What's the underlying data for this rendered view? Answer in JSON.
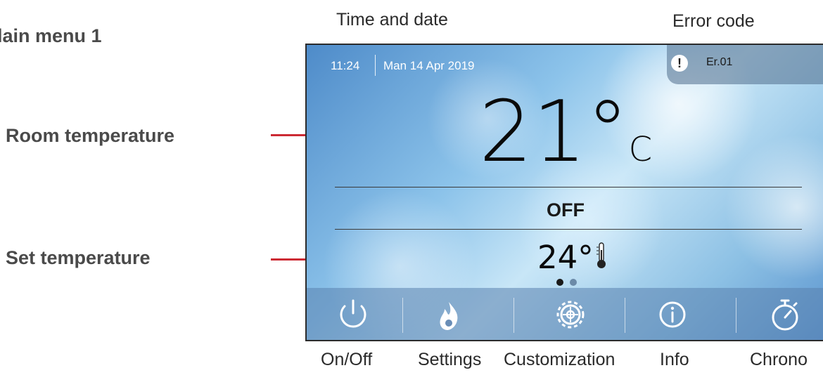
{
  "annotations": {
    "main_menu": "lain menu 1",
    "time_and_date": "Time and date",
    "error_code": "Error code",
    "room_temperature": "Room temperature",
    "set_temperature": "Set temperature"
  },
  "screen": {
    "time": "11:24",
    "date": "Man 14 Apr 2019",
    "error_code": "Er.01",
    "room_temperature": "21",
    "room_unit": "C",
    "state": "OFF",
    "set_temperature": "24",
    "page_dots": {
      "total": 2,
      "active": 0
    }
  },
  "bottom_bar": {
    "buttons": [
      {
        "label": "On/Off",
        "icon": "power-icon"
      },
      {
        "label": "Settings",
        "icon": "flame-icon"
      },
      {
        "label": "Customization",
        "icon": "gear-icon"
      },
      {
        "label": "Info",
        "icon": "info-icon"
      },
      {
        "label": "Chrono",
        "icon": "stopwatch-icon"
      }
    ]
  },
  "colors": {
    "arrow": "#cc2a33",
    "icon": "#ffffff",
    "dot_active": "#1a1a1a",
    "dot_inactive": "#6b8aa8"
  }
}
